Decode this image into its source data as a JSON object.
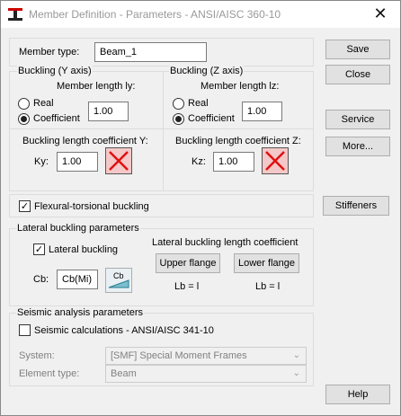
{
  "window": {
    "title": "Member Definition - Parameters - ANSI/AISC 360-10",
    "close_glyph": "✕"
  },
  "member": {
    "type_label": "Member type:",
    "type_value": "Beam_1"
  },
  "buckling_y": {
    "title": "Buckling (Y axis)",
    "length_label": "Member length ly:",
    "real_label": "Real",
    "coef_label": "Coefficient",
    "length_value": "1.00",
    "coef_title": "Buckling length coefficient Y:",
    "k_label": "Ky:",
    "k_value": "1.00"
  },
  "buckling_z": {
    "title": "Buckling (Z axis)",
    "length_label": "Member length lz:",
    "real_label": "Real",
    "coef_label": "Coefficient",
    "length_value": "1.00",
    "coef_title": "Buckling length coefficient Z:",
    "k_label": "Kz:",
    "k_value": "1.00"
  },
  "flexural": {
    "label": "Flexural-torsional buckling",
    "checked": true
  },
  "lateral": {
    "title": "Lateral buckling parameters",
    "checkbox_label": "Lateral buckling",
    "checked": true,
    "coef_title": "Lateral buckling length coefficient",
    "upper_label": "Upper flange",
    "lower_label": "Lower flange",
    "cb_label": "Cb:",
    "cb_value": "Cb(Mi)",
    "cb_icon_text": "Cb",
    "lb_upper": "Lb = l",
    "lb_lower": "Lb = l"
  },
  "seismic": {
    "title": "Seismic analysis parameters",
    "checkbox_label": "Seismic calculations - ANSI/AISC 341-10",
    "checked": false,
    "system_label": "System:",
    "system_value": "[SMF] Special Moment Frames",
    "element_label": "Element type:",
    "element_value": "Beam"
  },
  "buttons": {
    "save": "Save",
    "close": "Close",
    "service": "Service",
    "more": "More...",
    "stiffeners": "Stiffeners",
    "help": "Help"
  },
  "colors": {
    "x_button_fill": "#f4c8c8",
    "x_mark": "#e01010"
  }
}
